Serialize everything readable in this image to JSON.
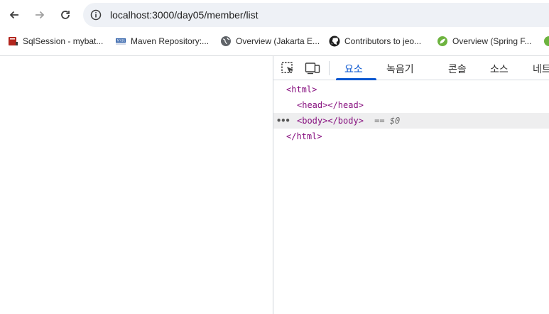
{
  "browser": {
    "url": "localhost:3000/day05/member/list",
    "bookmarks": [
      {
        "label": "SqlSession - mybat...",
        "icon": "book-icon"
      },
      {
        "label": "Maven Repository:...",
        "icon": "mvn-icon"
      },
      {
        "label": "Overview (Jakarta E...",
        "icon": "globe-icon"
      },
      {
        "label": "Contributors to jeo...",
        "icon": "github-icon"
      },
      {
        "label": "Overview (Spring F...",
        "icon": "spring-icon"
      }
    ]
  },
  "devtools": {
    "tabs": [
      "요소",
      "녹음기",
      "콘솔",
      "소스",
      "네트"
    ],
    "active_tab": "요소",
    "dom": {
      "line1": "<html>",
      "line2": "<head></head>",
      "line3": "<body></body>",
      "line3_suffix": "== $0",
      "line4": "</html>",
      "dots": "•••"
    }
  },
  "colors": {
    "accent": "#0b57d0",
    "tag": "#881280",
    "omnibox_bg": "#eef1f6"
  }
}
